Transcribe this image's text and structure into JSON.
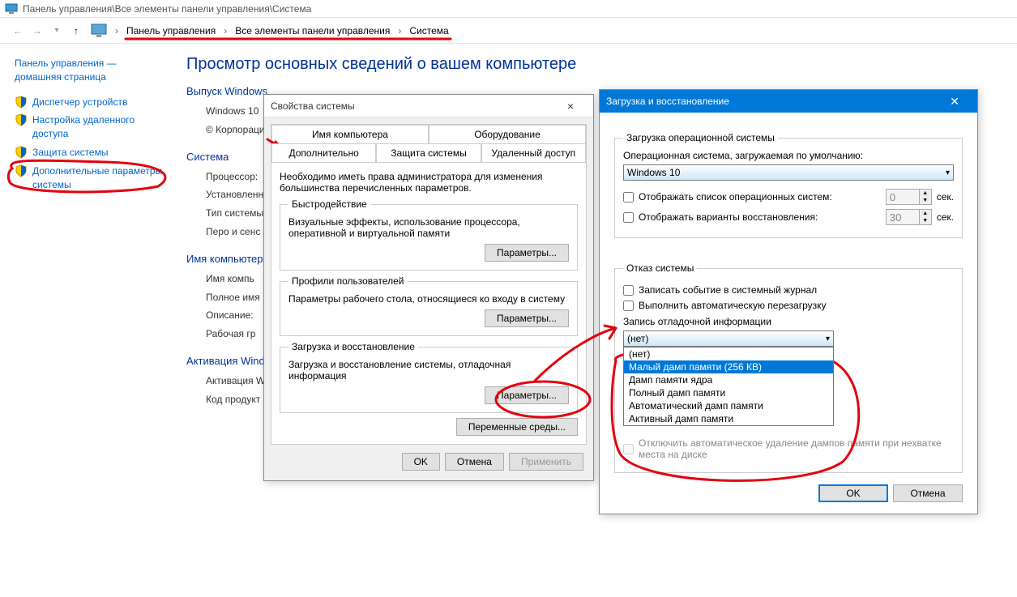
{
  "window": {
    "title_path": "Панель управления\\Все элементы панели управления\\Система"
  },
  "breadcrumb": {
    "items": [
      "Панель управления",
      "Все элементы панели управления",
      "Система"
    ]
  },
  "sidebar": {
    "home": "Панель управления — домашняя страница",
    "links": [
      "Диспетчер устройств",
      "Настройка удаленного доступа",
      "Защита системы",
      "Дополнительные параметры системы"
    ]
  },
  "main": {
    "heading": "Просмотр основных сведений о вашем компьютере",
    "groups": {
      "edition": {
        "title": "Выпуск Windows",
        "rows": [
          "Windows 10",
          "© Корпорация"
        ]
      },
      "system": {
        "title": "Система",
        "rows": [
          "Процессор:",
          "Установленн (ОЗУ):",
          "Тип системы",
          "Перо и сенс"
        ]
      },
      "computer": {
        "title": "Имя компьютер",
        "rows": [
          "Имя компь",
          "Полное имя",
          "Описание:",
          "Рабочая гр"
        ]
      },
      "activation": {
        "title": "Активация Wind",
        "rows": [
          "Активация W",
          "Код продукт"
        ]
      }
    }
  },
  "sysprops": {
    "title": "Свойства системы",
    "tabs_row1": [
      "Имя компьютера",
      "Оборудование"
    ],
    "tabs_row2": [
      "Дополнительно",
      "Защита системы",
      "Удаленный доступ"
    ],
    "note": "Необходимо иметь права администратора для изменения большинства перечисленных параметров.",
    "perf": {
      "legend": "Быстродействие",
      "desc": "Визуальные эффекты, использование процессора, оперативной и виртуальной памяти"
    },
    "profiles": {
      "legend": "Профили пользователей",
      "desc": "Параметры рабочего стола, относящиеся ко входу в систему"
    },
    "startup": {
      "legend": "Загрузка и восстановление",
      "desc": "Загрузка и восстановление системы, отладочная информация"
    },
    "params_btn": "Параметры...",
    "env_btn": "Переменные среды...",
    "ok": "OK",
    "cancel": "Отмена",
    "apply": "Применить"
  },
  "startup_dlg": {
    "title": "Загрузка и восстановление",
    "boot_group": "Загрузка операционной системы",
    "default_os_label": "Операционная система, загружаемая по умолчанию:",
    "default_os_value": "Windows 10",
    "show_os_list": "Отображать список операционных систем:",
    "show_os_secs": "0",
    "show_recovery": "Отображать варианты восстановления:",
    "show_recovery_secs": "30",
    "sec_label": "сек.",
    "failure_group": "Отказ системы",
    "write_event": "Записать событие в системный журнал",
    "auto_restart": "Выполнить автоматическую перезагрузку",
    "dump_label": "Запись отладочной информации",
    "dump_selected": "(нет)",
    "dump_options": [
      "(нет)",
      "Малый дамп памяти (256 КВ)",
      "Дамп памяти ядра",
      "Полный дамп памяти",
      "Автоматический дамп памяти",
      "Активный дамп памяти"
    ],
    "dump_highlight_index": 1,
    "disable_auto_delete": "Отключить автоматическое удаление дампов памяти при нехватке места на диске",
    "ok": "OK",
    "cancel": "Отмена"
  }
}
